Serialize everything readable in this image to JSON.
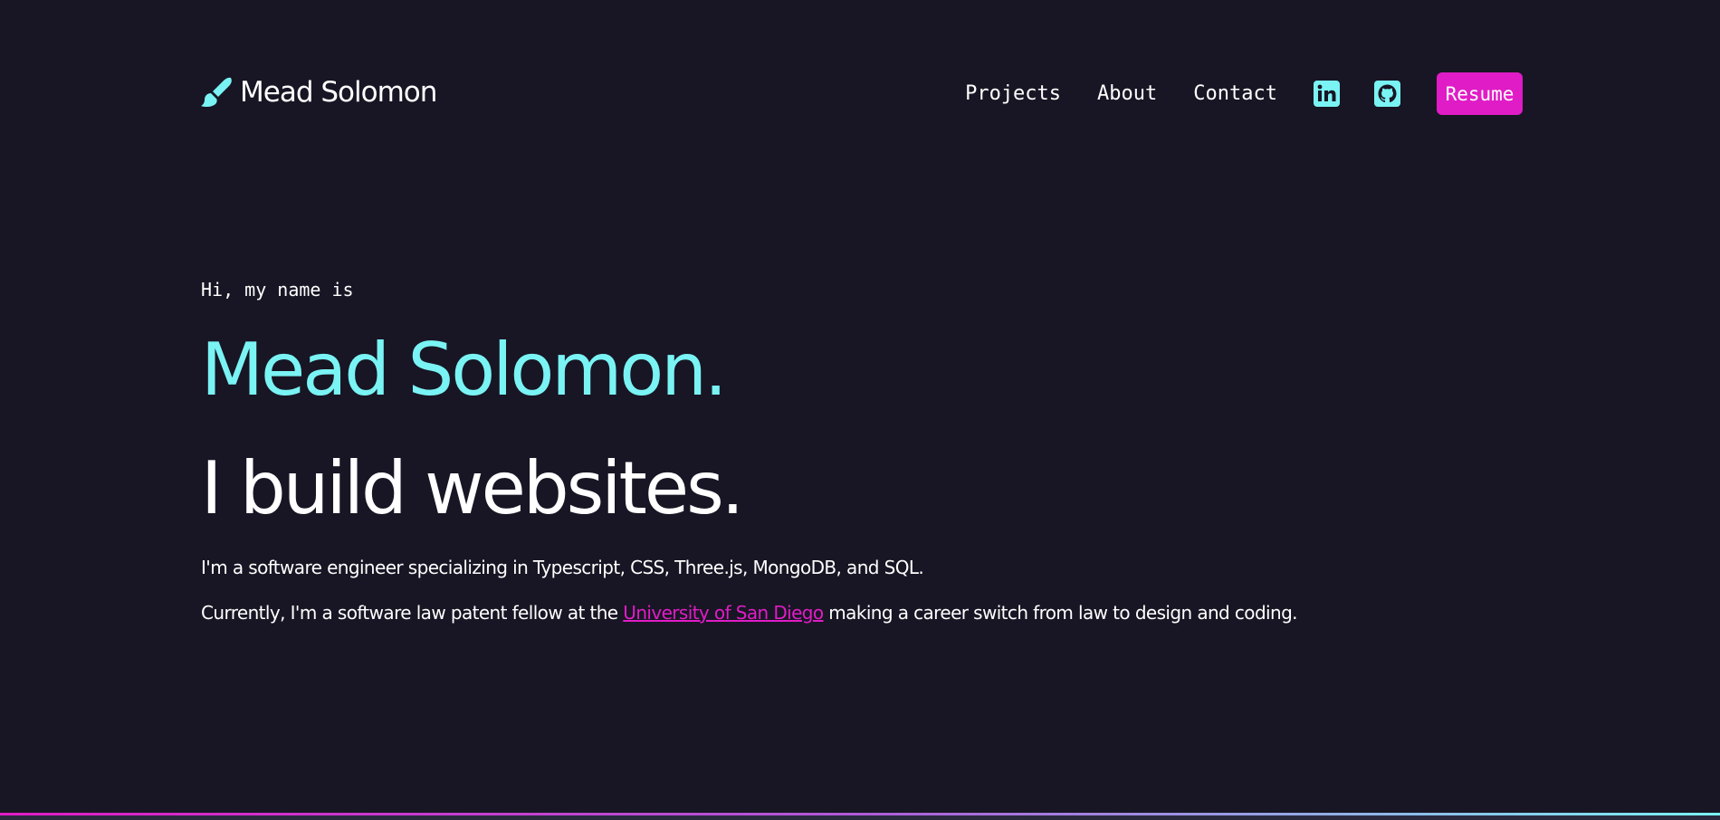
{
  "header": {
    "logo_text": "Mead Solomon",
    "logo_icon": "paintbrush-icon",
    "nav": [
      {
        "label": "Projects"
      },
      {
        "label": "About"
      },
      {
        "label": "Contact"
      }
    ],
    "social": [
      {
        "icon": "linkedin-icon"
      },
      {
        "icon": "github-icon"
      }
    ],
    "resume_label": "Resume"
  },
  "hero": {
    "greeting": "Hi, my name is",
    "name": "Mead Solomon.",
    "tagline": "I build websites.",
    "bio_line_1": "I'm a software engineer specializing in Typescript, CSS, Three.js, MongoDB, and SQL.",
    "bio_line_2_before": "Currently, I'm a software law patent fellow at the ",
    "bio_line_2_link": "University of San Diego",
    "bio_line_2_after": " making a career switch from law to design and coding."
  },
  "colors": {
    "background": "#181624",
    "accent_cyan": "#7af3f4",
    "accent_magenta": "#e01cc6",
    "text": "#ffffff"
  }
}
